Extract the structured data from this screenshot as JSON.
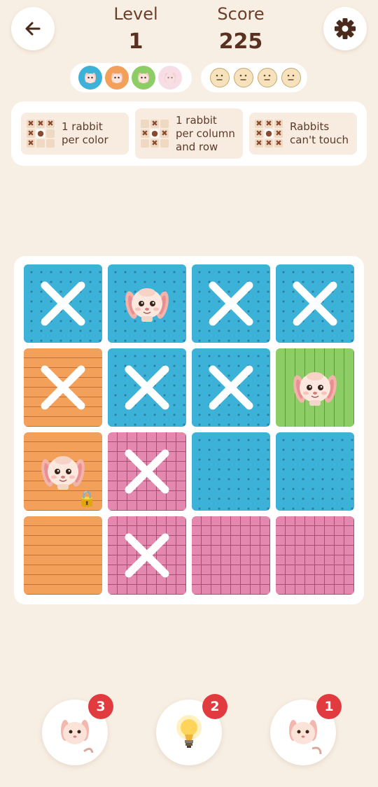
{
  "header": {
    "level_label": "Level",
    "level_value": "1",
    "score_label": "Score",
    "score_value": "225",
    "back_icon": "arrow-left-icon",
    "settings_icon": "gear-icon"
  },
  "colors_row": [
    "blue",
    "orange",
    "green",
    "pink"
  ],
  "faces": [
    "neutral-face",
    "neutral-face",
    "neutral-face",
    "neutral-face"
  ],
  "rules": [
    {
      "text": "1 rabbit\nper color"
    },
    {
      "text": "1 rabbit\nper column\nand row"
    },
    {
      "text": "Rabbits\ncan't touch"
    }
  ],
  "board": {
    "rows": [
      [
        {
          "color": "blue",
          "state": "x"
        },
        {
          "color": "blue",
          "state": "rabbit"
        },
        {
          "color": "blue",
          "state": "x"
        },
        {
          "color": "blue",
          "state": "x"
        }
      ],
      [
        {
          "color": "orange",
          "state": "x"
        },
        {
          "color": "blue",
          "state": "x"
        },
        {
          "color": "blue",
          "state": "x"
        },
        {
          "color": "green",
          "state": "rabbit"
        }
      ],
      [
        {
          "color": "orange",
          "state": "rabbit-locked"
        },
        {
          "color": "pink",
          "state": "x"
        },
        {
          "color": "blue",
          "state": "empty"
        },
        {
          "color": "blue",
          "state": "empty"
        }
      ],
      [
        {
          "color": "orange",
          "state": "empty"
        },
        {
          "color": "pink",
          "state": "x"
        },
        {
          "color": "pink",
          "state": "empty"
        },
        {
          "color": "pink",
          "state": "empty"
        }
      ]
    ]
  },
  "powerups": [
    {
      "name": "undo-rabbit",
      "count": "3"
    },
    {
      "name": "hint-bulb",
      "count": "2"
    },
    {
      "name": "swap-rabbit",
      "count": "1"
    }
  ],
  "palette": {
    "blue": "#3db2d9",
    "orange": "#f2a05a",
    "green": "#8ccd66",
    "pink": "#e488b0",
    "badge": "#e23b3f"
  }
}
